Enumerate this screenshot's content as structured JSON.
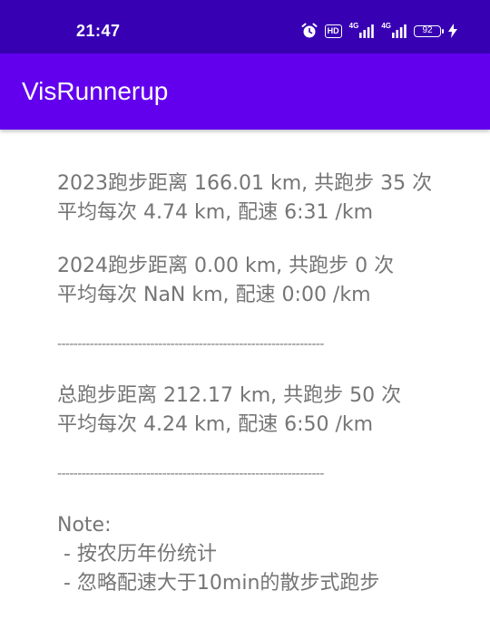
{
  "status_bar": {
    "time": "21:47",
    "hd_label": "HD",
    "network_label_1": "4G",
    "network_label_2": "4G",
    "battery_level": "92",
    "icons": [
      "alarm-icon",
      "hd-icon",
      "signal-4g-icon",
      "signal-4g-icon",
      "battery-icon",
      "charging-bolt-icon"
    ]
  },
  "app_bar": {
    "title": "VisRunnerup"
  },
  "colors": {
    "status_bar": "#3700b3",
    "app_bar": "#6200ee",
    "text": "#757575"
  },
  "stats": {
    "year_2023": {
      "line1": "2023跑步距离 166.01 km, 共跑步 35 次",
      "line2": "平均每次 4.74 km, 配速 6:31 /km"
    },
    "year_2024": {
      "line1": "2024跑步距离 0.00 km, 共跑步 0 次",
      "line2": "平均每次 NaN km, 配速 0:00 /km"
    },
    "divider": "------------------------------------------------------------------",
    "total": {
      "line1": "总跑步距离 212.17 km, 共跑步 50 次",
      "line2": "平均每次 4.24 km, 配速 6:50 /km"
    },
    "divider2": "------------------------------------------------------------------",
    "note": {
      "title": "Note:",
      "item1": " - 按农历年份统计",
      "item2": " - 忽略配速大于10min的散步式跑步"
    }
  }
}
